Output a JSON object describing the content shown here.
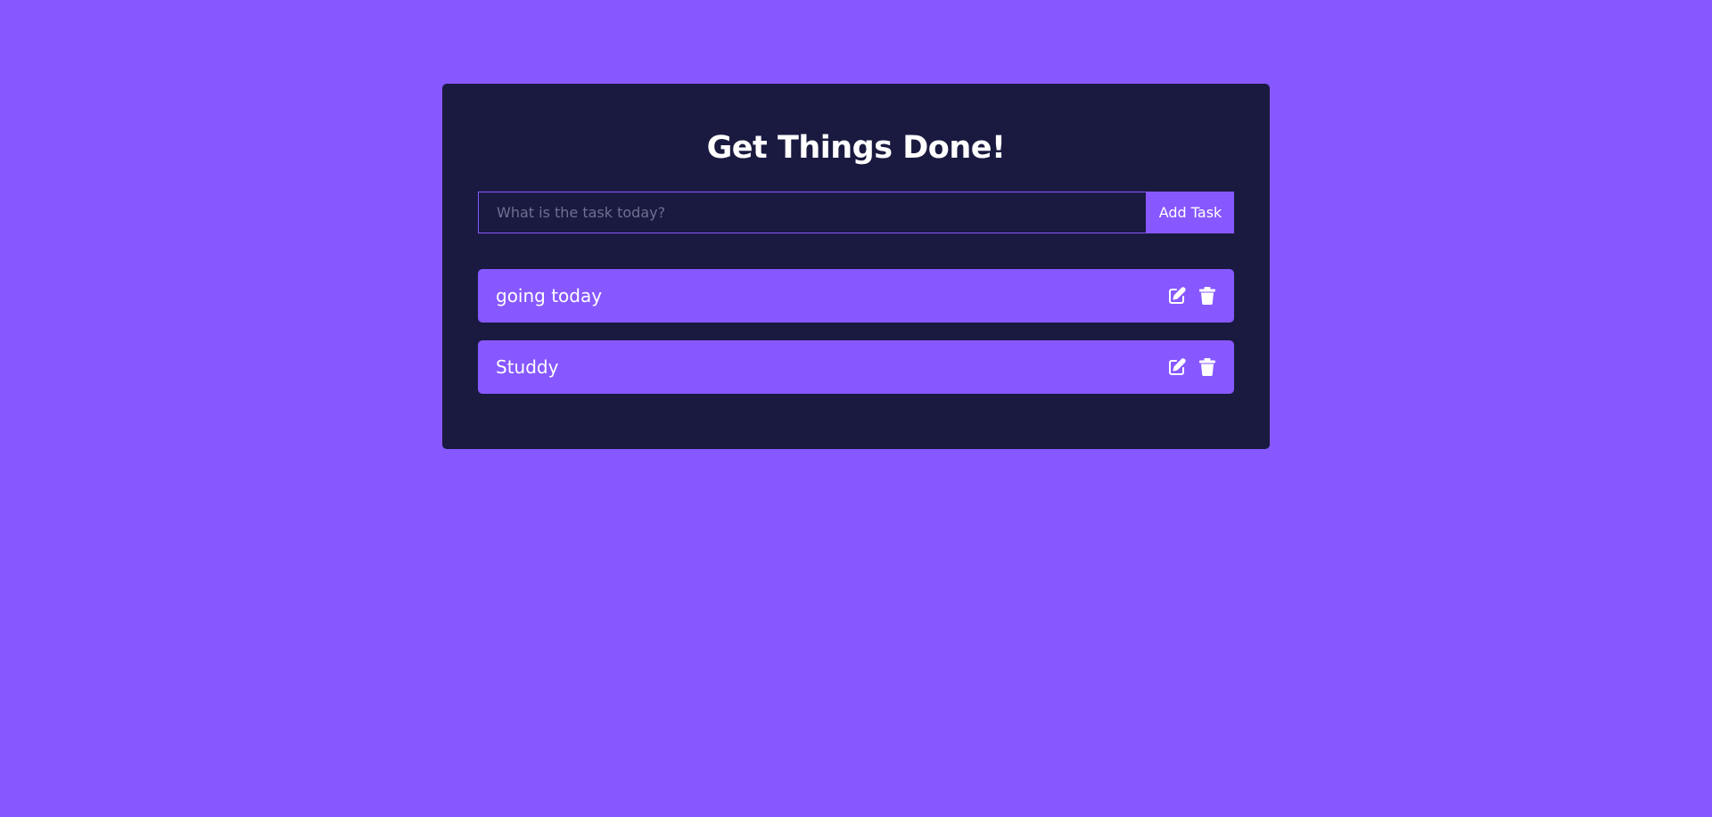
{
  "app": {
    "title": "Get Things Done!"
  },
  "form": {
    "input_value": "",
    "input_placeholder": "What is the task today?",
    "add_button_label": "Add Task"
  },
  "tasks": [
    {
      "text": "going today",
      "edit_icon": "edit-icon",
      "delete_icon": "trash-icon"
    },
    {
      "text": "Studdy",
      "edit_icon": "edit-icon",
      "delete_icon": "trash-icon"
    }
  ],
  "colors": {
    "background": "#8758ff",
    "panel": "#1a1a40",
    "accent": "#8758ff",
    "text": "#ffffff",
    "placeholder": "#6f6f93"
  }
}
